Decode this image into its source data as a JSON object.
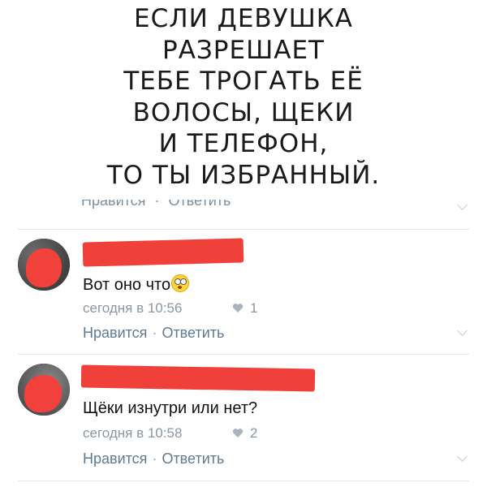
{
  "meme": {
    "lines": [
      "ЕСЛИ ДЕВУШКА",
      "РАЗРЕШАЕТ",
      "ТЕБЕ ТРОГАТЬ ЕЁ",
      "ВОЛОСЫ, ЩЕКИ",
      "И ТЕЛЕФОН,",
      "ТО ТЫ ИЗБРАННЫЙ."
    ]
  },
  "previous_comment": {
    "like_label": "Нравится",
    "separator": "·",
    "reply_label": "Ответить"
  },
  "comments": [
    {
      "text": "Вот оно что",
      "emoji": "astonished-emoji",
      "time": "сегодня в 10:56",
      "likes": "1",
      "like_label": "Нравится",
      "separator": "·",
      "reply_label": "Ответить"
    },
    {
      "text": "Щёки изнутри или нет?",
      "time": "сегодня в 10:58",
      "likes": "2",
      "like_label": "Нравится",
      "separator": "·",
      "reply_label": "Ответить"
    }
  ],
  "colors": {
    "redaction": "#ef403a",
    "link": "#5f7a93",
    "meta": "#8a97a3"
  }
}
